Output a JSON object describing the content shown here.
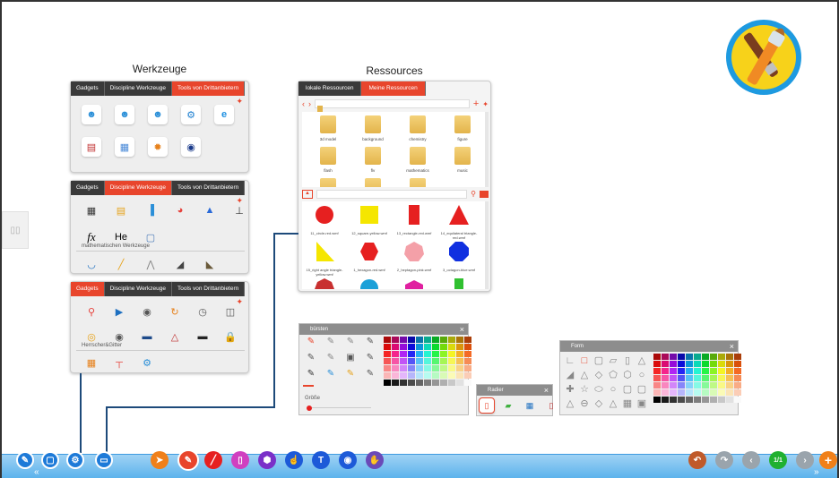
{
  "werkzeuge": {
    "title": "Werkzeuge",
    "panel1": {
      "tabs": [
        "Gadgets",
        "Discipline Werkzeuge",
        "Tools von Drittanbietern"
      ],
      "active": 2
    },
    "panel2": {
      "tabs": [
        "Gadgets",
        "Discipline Werkzeuge",
        "Tools von Drittanbietern"
      ],
      "active": 1,
      "fx": "fx",
      "he": "He",
      "section": "mathematischen Werkzeuge"
    },
    "panel3": {
      "tabs": [
        "Gadgets",
        "Discipline Werkzeuge",
        "Tools von Drittanbietern"
      ],
      "active": 0,
      "section": "Herrscher&Gitter"
    }
  },
  "ressources": {
    "title": "Ressources",
    "tabs": [
      "lokale Ressourcen",
      "Meine Ressourcen"
    ],
    "active": 1,
    "folders": [
      "3d model",
      "background",
      "chemistry",
      "figure",
      "flash",
      "flv",
      "mathematics",
      "music"
    ],
    "shapes": [
      "11_circle-red.wmf",
      "12_square-yellow.wmf",
      "13_rectangle-red.wmf",
      "14_equilateral triangle-red.wmf",
      "15_right angle triangle-yellow.wmf",
      "1_hexagon-red.wmf",
      "2_heptagon-pink.wmf",
      "3_octagon-blue.wmf",
      "4_nonagon-red.wmf",
      "5_decagon-blue.wmf",
      "6_cube-pink.wmf",
      "7_cuboid-green.wmf"
    ],
    "shape_colors": [
      "#e62020",
      "#f5e600",
      "#e62020",
      "#e62020",
      "#f5e600",
      "#e62020",
      "#f4a0a8",
      "#1030e0",
      "#c83030",
      "#1ba0d8",
      "#e020a0",
      "#30c030"
    ]
  },
  "buersten": {
    "title": "bürsten",
    "size_label": "Größe"
  },
  "radier": {
    "title": "Radier"
  },
  "form": {
    "title": "Form"
  },
  "toolbar": {
    "page": "1/1"
  },
  "colors": {
    "accent": "#e8452c",
    "dark": "#3a3a3a",
    "toolbar": "#5cb3ec"
  }
}
